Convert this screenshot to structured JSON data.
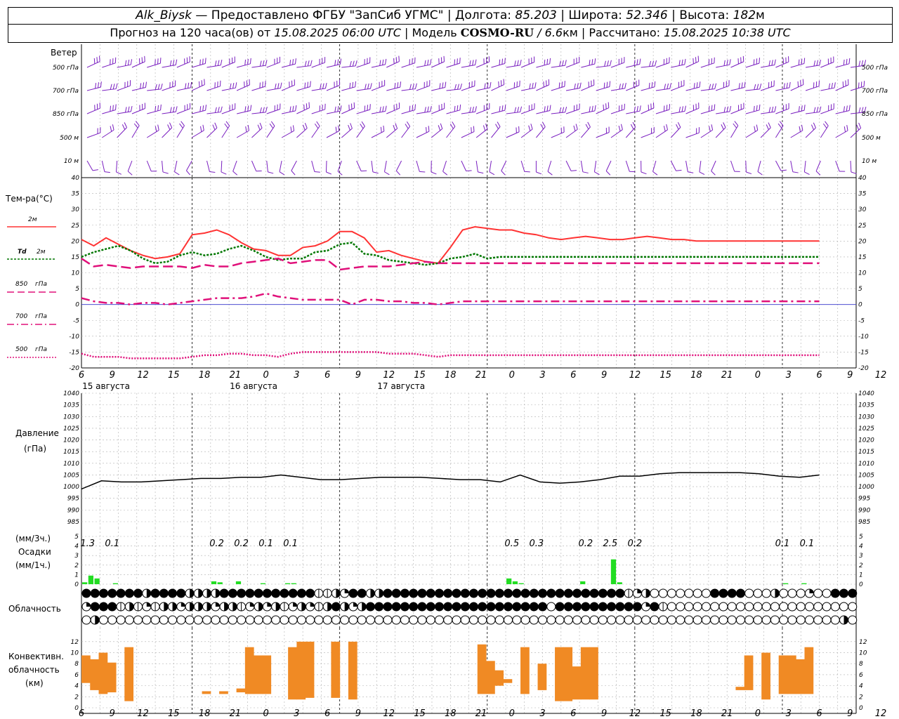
{
  "header": {
    "station": "Alk_Biysk",
    "provider": " — Предоставлено ФГБУ \"ЗапСиб УГМС\" | ",
    "lon_label": "Долгота: ",
    "lon": "85.203",
    "lat_label": " | Широта: ",
    "lat": "52.346",
    "alt_label": " | Высота: ",
    "alt": "182",
    "alt_unit": "м",
    "forecast_text": "Прогноз на 120 часа(ов) от ",
    "forecast_start": "15.08.2025 06:00 UTC",
    "model_label": "  | Модель ",
    "model": "COSMO-RU",
    "model_res": " / 6.6",
    "model_res_unit": "км",
    "calc_label": " | Рассчитано: ",
    "calc_time": "15.08.2025 10:38 UTC"
  },
  "colors": {
    "t2m": "#ff3333",
    "td2m": "#007700",
    "t850": "#e0107a",
    "t700": "#e0107a",
    "t500": "#e0107a",
    "pressure": "#000000",
    "precip": "#22dd22",
    "convective": "#f08a24",
    "wind": "#7a1fc0",
    "grid": "#b0b0b0"
  },
  "labels": {
    "wind": "Ветер",
    "wind_levels": [
      "500 гПа",
      "700 гПа",
      "850 гПа",
      "500  м",
      "10   м"
    ],
    "temp": "Тем-ра(°C)",
    "legend_t2m": "2м",
    "legend_td": "Td",
    "legend_td_unit": "2м",
    "legend_850": "850",
    "legend_700": "700",
    "legend_500": "500",
    "legend_unit": "гПа",
    "pressure_1": "Давление",
    "pressure_2": "(гПа)",
    "precip_1": "(мм/3ч.)",
    "precip_2": "Осадки",
    "precip_3": "(мм/1ч.)",
    "cloud": "Облачность",
    "conv_1": "Конвективн.",
    "conv_2": "облачность",
    "conv_3": "(км)"
  },
  "chart_data": [
    {
      "type": "line",
      "name": "temperature",
      "x_hours": [
        0,
        3,
        6,
        9,
        12,
        15,
        18,
        21,
        24,
        27,
        30,
        33,
        36,
        39,
        42,
        45,
        48,
        51,
        54,
        57,
        60,
        63,
        66,
        69,
        72,
        75,
        78,
        81,
        84,
        87,
        90,
        93,
        96,
        99,
        102,
        105,
        108,
        111,
        114,
        117,
        120,
        123,
        126,
        129,
        132,
        135,
        138,
        141,
        144,
        147,
        150,
        153,
        156,
        159,
        162,
        165,
        168,
        171,
        174,
        177,
        180
      ],
      "x_ticks": [
        "6",
        "9",
        "12",
        "15",
        "18",
        "21",
        "0",
        "3",
        "6",
        "9",
        "12",
        "15",
        "18",
        "21",
        "0",
        "3",
        "6",
        "9",
        "12",
        "15",
        "18",
        "21",
        "0",
        "3",
        "6",
        "9",
        "12"
      ],
      "dates": [
        "15 августа",
        "16 августа",
        "17 августа"
      ],
      "ylim": [
        -20,
        40
      ],
      "y_ticks": [
        -20,
        -15,
        -10,
        -5,
        0,
        5,
        10,
        15,
        20,
        25,
        30,
        35,
        40
      ],
      "series": [
        {
          "name": "2м",
          "values": [
            20.5,
            18.5,
            21,
            19,
            17,
            15.5,
            14.5,
            15,
            16,
            22,
            22.5,
            23.5,
            22,
            19.5,
            17.5,
            17,
            15.5,
            15.5,
            18,
            18.5,
            20,
            23,
            23,
            21,
            16.5,
            17,
            15.5,
            14.5,
            13.5,
            13,
            18,
            23.5,
            24.5,
            24,
            23.5,
            23.5,
            22.5,
            22,
            21,
            20.5,
            21,
            21.5,
            21,
            20.5,
            20.5,
            21,
            21.5,
            21,
            20.5,
            20.5,
            20,
            20,
            20,
            20,
            20,
            20,
            20,
            20,
            20,
            20,
            20
          ]
        },
        {
          "name": "Td 2м",
          "values": [
            15,
            16.5,
            17.5,
            18.5,
            17,
            14.5,
            13,
            13.5,
            15.5,
            16.5,
            15.5,
            16,
            17.5,
            18.5,
            17,
            15,
            14,
            14.5,
            14.5,
            16.5,
            17,
            19,
            19.5,
            16,
            15.5,
            14,
            13.5,
            13,
            12.5,
            13,
            14.5,
            15,
            16,
            14.5,
            15,
            15,
            15,
            15,
            15,
            15,
            15,
            15,
            15,
            15,
            15,
            15,
            15,
            15,
            15,
            15,
            15,
            15,
            15,
            15,
            15,
            15,
            15,
            15,
            15,
            15,
            15
          ]
        },
        {
          "name": "850 гПа",
          "values": [
            14.5,
            12,
            12.5,
            12,
            11.5,
            12,
            12,
            12,
            12,
            11.5,
            12.5,
            12,
            12,
            13,
            13.5,
            14,
            14.5,
            13,
            13.5,
            14,
            14,
            11,
            11.5,
            12,
            12,
            12,
            12.5,
            13,
            13.5,
            13,
            13,
            13,
            13,
            13,
            13,
            13,
            13,
            13,
            13,
            13,
            13,
            13,
            13,
            13,
            13,
            13,
            13,
            13,
            13,
            13,
            13,
            13,
            13,
            13,
            13,
            13,
            13,
            13,
            13,
            13,
            13
          ]
        },
        {
          "name": "700 гПа",
          "values": [
            2,
            1,
            0.5,
            0.5,
            0,
            0.5,
            0.5,
            0,
            0.5,
            1,
            1.5,
            2,
            2,
            2,
            2.5,
            3.5,
            2.5,
            2,
            1.5,
            1.5,
            1.5,
            1.5,
            0,
            1.5,
            1.5,
            1,
            1,
            0.5,
            0.5,
            0,
            0.5,
            1,
            1,
            1,
            1,
            1,
            1,
            1,
            1,
            1,
            1,
            1,
            1,
            1,
            1,
            1,
            1,
            1,
            1,
            1,
            1,
            1,
            1,
            1,
            1,
            1,
            1,
            1,
            1,
            1,
            1
          ]
        },
        {
          "name": "500 гПа",
          "values": [
            -15.5,
            -16.5,
            -16.5,
            -16.5,
            -17,
            -17,
            -17,
            -17,
            -17,
            -16.5,
            -16,
            -16,
            -15.5,
            -15.5,
            -16,
            -16,
            -16.5,
            -15.5,
            -15,
            -15,
            -15,
            -15,
            -15,
            -15,
            -15,
            -15.5,
            -15.5,
            -15.5,
            -16,
            -16.5,
            -16,
            -16,
            -16,
            -16,
            -16,
            -16,
            -16,
            -16,
            -16,
            -16,
            -16,
            -16,
            -16,
            -16,
            -16,
            -16,
            -16,
            -16,
            -16,
            -16,
            -16,
            -16,
            -16,
            -16,
            -16,
            -16,
            -16,
            -16,
            -16,
            -16,
            -16
          ]
        }
      ]
    },
    {
      "type": "line",
      "name": "pressure",
      "ylim": [
        985,
        1040
      ],
      "y_ticks": [
        985,
        990,
        995,
        1000,
        1005,
        1010,
        1015,
        1020,
        1025,
        1030,
        1035,
        1040
      ],
      "values": [
        999,
        1002.5,
        1002,
        1002,
        1002.5,
        1003,
        1003.5,
        1003.5,
        1004,
        1004,
        1005,
        1004,
        1003,
        1003,
        1003.5,
        1004,
        1004,
        1004,
        1003.5,
        1003,
        1003,
        1002,
        1005,
        1002,
        1001.5,
        1002,
        1003,
        1004.5,
        1004.5,
        1005.5,
        1006,
        1006,
        1006,
        1006,
        1005.5,
        1004.5,
        1004,
        1005
      ]
    },
    {
      "type": "bar",
      "name": "precipitation",
      "ylim": [
        0,
        5
      ],
      "y_ticks": [
        0,
        1,
        2,
        3,
        4,
        5
      ],
      "labels_3h": [
        {
          "h": 1,
          "text": "1.3"
        },
        {
          "h": 5,
          "text": "0.1"
        },
        {
          "h": 22,
          "text": "0.2"
        },
        {
          "h": 26,
          "text": "0.2"
        },
        {
          "h": 30,
          "text": "0.1"
        },
        {
          "h": 34,
          "text": "0.1"
        },
        {
          "h": 70,
          "text": "0.5"
        },
        {
          "h": 74,
          "text": "0.3"
        },
        {
          "h": 82,
          "text": "0.2"
        },
        {
          "h": 86,
          "text": "2.5"
        },
        {
          "h": 90,
          "text": "0.2"
        },
        {
          "h": 114,
          "text": "0.1"
        },
        {
          "h": 118,
          "text": "0.1"
        }
      ],
      "bars_1h": [
        {
          "h": 0,
          "v": 0.2
        },
        {
          "h": 1,
          "v": 0.9
        },
        {
          "h": 2,
          "v": 0.6
        },
        {
          "h": 5,
          "v": 0.1
        },
        {
          "h": 21,
          "v": 0.3
        },
        {
          "h": 22,
          "v": 0.2
        },
        {
          "h": 25,
          "v": 0.3
        },
        {
          "h": 29,
          "v": 0.1
        },
        {
          "h": 33,
          "v": 0.1
        },
        {
          "h": 34,
          "v": 0.1
        },
        {
          "h": 69,
          "v": 0.6
        },
        {
          "h": 70,
          "v": 0.3
        },
        {
          "h": 71,
          "v": 0.1
        },
        {
          "h": 81,
          "v": 0.3
        },
        {
          "h": 86,
          "v": 2.6
        },
        {
          "h": 87,
          "v": 0.2
        },
        {
          "h": 114,
          "v": 0.1
        },
        {
          "h": 117,
          "v": 0.1
        }
      ]
    },
    {
      "type": "table",
      "name": "cloudiness",
      "rows": [
        "FFFFFFFHFFFFHHHHFFFFFFFFFFFTTHQFFHHFFFFFFFFFFFFFFFFFFFFFFFFFFFFTQHEEEEEEEFFFFEEEHEEEQEEFFFF",
        "QFFFTHTQTHHQHHHQHHTQHQHTQHQTHFHQHFFFFFFFFFFFFFFFFFFFFFEFFFFFFFFFFQFTEEEEEEEEEEEEEEEEEEEEEE",
        "EHEEEEEEEEEEEEEEEEEEEEEEEEEEEEEEEEEEEEEEEEEEEEEEEEEEEEEEEEEEEEEEEEEEEEEEEEEEEEEEEEEEEEEEHE"
      ]
    },
    {
      "type": "bar",
      "name": "convective_cloud",
      "ylim": [
        0,
        13
      ],
      "y_ticks": [
        0,
        2,
        4,
        6,
        8,
        10,
        12
      ],
      "bars": [
        {
          "h": 0,
          "bottom": 4.5,
          "top": 9.5
        },
        {
          "h": 1,
          "bottom": 3.2,
          "top": 8.8
        },
        {
          "h": 2,
          "bottom": 2.5,
          "top": 10
        },
        {
          "h": 3,
          "bottom": 2.8,
          "top": 8.2
        },
        {
          "h": 5,
          "bottom": 1.2,
          "top": 11
        },
        {
          "h": 14,
          "bottom": 2.5,
          "top": 3
        },
        {
          "h": 16,
          "bottom": 2.5,
          "top": 3
        },
        {
          "h": 18,
          "bottom": 2.8,
          "top": 3.5
        },
        {
          "h": 19,
          "bottom": 2.5,
          "top": 11
        },
        {
          "h": 20,
          "bottom": 2.5,
          "top": 9.5
        },
        {
          "h": 21,
          "bottom": 2.5,
          "top": 9.5
        },
        {
          "h": 24,
          "bottom": 1.5,
          "top": 11
        },
        {
          "h": 25,
          "bottom": 1.5,
          "top": 12
        },
        {
          "h": 26,
          "bottom": 1.8,
          "top": 12
        },
        {
          "h": 29,
          "bottom": 1.8,
          "top": 12
        },
        {
          "h": 31,
          "bottom": 1.5,
          "top": 12
        },
        {
          "h": 46,
          "bottom": 2.5,
          "top": 11.5
        },
        {
          "h": 47,
          "bottom": 2.5,
          "top": 8.5
        },
        {
          "h": 48,
          "bottom": 4,
          "top": 6.8
        },
        {
          "h": 49,
          "bottom": 4.5,
          "top": 5.2
        },
        {
          "h": 51,
          "bottom": 2.5,
          "top": 11
        },
        {
          "h": 53,
          "bottom": 3.2,
          "top": 8
        },
        {
          "h": 55,
          "bottom": 1.2,
          "top": 11
        },
        {
          "h": 56,
          "bottom": 1.2,
          "top": 11
        },
        {
          "h": 57,
          "bottom": 1.5,
          "top": 7.5
        },
        {
          "h": 58,
          "bottom": 1.5,
          "top": 11
        },
        {
          "h": 59,
          "bottom": 1.5,
          "top": 11
        },
        {
          "h": 76,
          "bottom": 3.2,
          "top": 3.8
        },
        {
          "h": 77,
          "bottom": 3.2,
          "top": 9.5
        },
        {
          "h": 79,
          "bottom": 1.5,
          "top": 10
        },
        {
          "h": 81,
          "bottom": 2.5,
          "top": 9.5
        },
        {
          "h": 82,
          "bottom": 2.5,
          "top": 9.5
        },
        {
          "h": 83,
          "bottom": 2.5,
          "top": 8.8
        },
        {
          "h": 84,
          "bottom": 2.5,
          "top": 11
        }
      ]
    }
  ]
}
